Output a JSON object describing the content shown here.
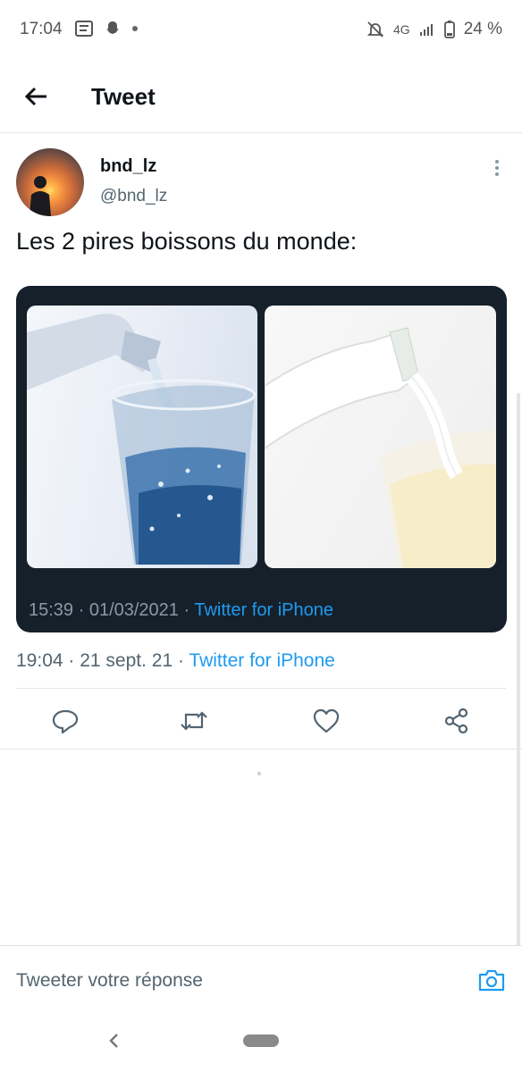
{
  "status_bar": {
    "time": "17:04",
    "network": "4G",
    "battery": "24 %",
    "icons": [
      "notification-icon",
      "snapchat-icon",
      "dot",
      "mute-icon",
      "signal-icon",
      "battery-icon"
    ]
  },
  "header": {
    "title": "Tweet",
    "back_icon": "arrow-left-icon"
  },
  "tweet": {
    "author_name": "bnd_lz",
    "author_handle": "@bnd_lz",
    "text": "Les 2 pires boissons du monde:",
    "media": {
      "inner_timestamp": "15:39 · 01/03/2021 · ",
      "inner_source": "Twitter for iPhone",
      "images": [
        "water-glass-image",
        "milk-glass-image"
      ]
    },
    "timestamp": "19:04 · 21 sept. 21 · ",
    "source": "Twitter for iPhone"
  },
  "actions": [
    {
      "name": "reply",
      "icon": "reply-icon"
    },
    {
      "name": "retweet",
      "icon": "retweet-icon"
    },
    {
      "name": "like",
      "icon": "heart-icon"
    },
    {
      "name": "share",
      "icon": "share-icon"
    }
  ],
  "reply_bar": {
    "placeholder": "Tweeter votre réponse",
    "camera_icon": "camera-icon"
  },
  "nav": {
    "back_icon": "nav-back-icon",
    "home_icon": "nav-home-pill"
  },
  "colors": {
    "accent": "#1d9bf0",
    "text": "#0f1419",
    "secondary": "#536471",
    "media_bg": "#15202b"
  }
}
